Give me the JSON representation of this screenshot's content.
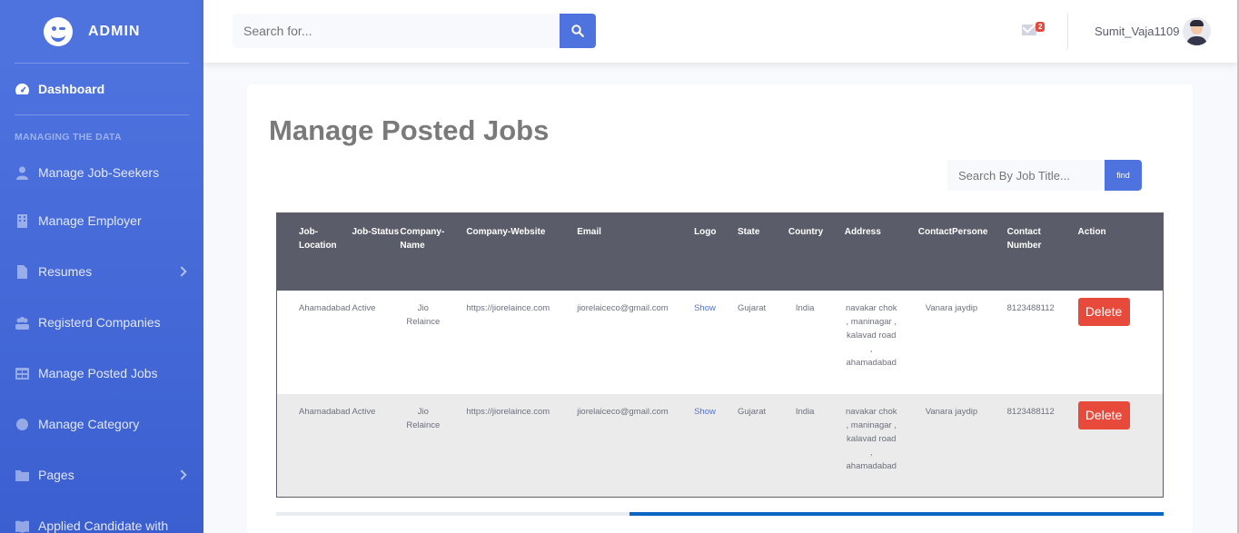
{
  "sidebar": {
    "brand": "ADMIN",
    "dashboard": "Dashboard",
    "section_heading": "MANAGING THE DATA",
    "items": [
      {
        "label": "Manage Job-Seekers",
        "icon": "user-icon"
      },
      {
        "label": "Manage Employer",
        "icon": "building-icon"
      },
      {
        "label": "Resumes",
        "icon": "file-icon"
      },
      {
        "label": "Registerd Companies",
        "icon": "people-icon"
      },
      {
        "label": "Manage Posted Jobs",
        "icon": "table-icon"
      },
      {
        "label": "Manage Category",
        "icon": "circle-icon"
      },
      {
        "label": "Pages",
        "icon": "folder-icon"
      },
      {
        "label": "Applied Candidate with",
        "icon": "book-icon"
      }
    ]
  },
  "topbar": {
    "search_placeholder": "Search for...",
    "mail_badge": "2",
    "username": "Sumit_Vaja1109"
  },
  "main": {
    "title": "Manage Posted Jobs",
    "job_search_placeholder": "Search By Job Title...",
    "find_label": "find",
    "columns": [
      "Job-Location",
      "Job-Status",
      "Company-Name",
      "Company-Website",
      "Email",
      "Logo",
      "State",
      "Country",
      "Address",
      "ContactPersone",
      "Contact Number",
      "Action"
    ],
    "rows": [
      {
        "location": "Ahamadabad",
        "status": "Active",
        "company": "Jio Relaince",
        "website": "https://jiorelaince.com",
        "email": "jiorelaiceco@gmail.com",
        "logo": "Show",
        "state": "Gujarat",
        "country": "India",
        "address": "navakar chok , maninagar , kalavad road , ahamadabad",
        "contact_person": "Vanara jaydip",
        "contact_number": "8123488112",
        "action": "Delete"
      },
      {
        "location": "Ahamadabad",
        "status": "Active",
        "company": "Jio Relaince",
        "website": "https://jiorelaince.com",
        "email": "jiorelaiceco@gmail.com",
        "logo": "Show",
        "state": "Gujarat",
        "country": "India",
        "address": "navakar chok , maninagar , kalavad road , ahamadabad",
        "contact_person": "Vanara jaydip",
        "contact_number": "8123488112",
        "action": "Delete"
      }
    ]
  },
  "colors": {
    "primary": "#4e73df",
    "danger": "#e74a3b",
    "table_header": "#5a5c69"
  }
}
